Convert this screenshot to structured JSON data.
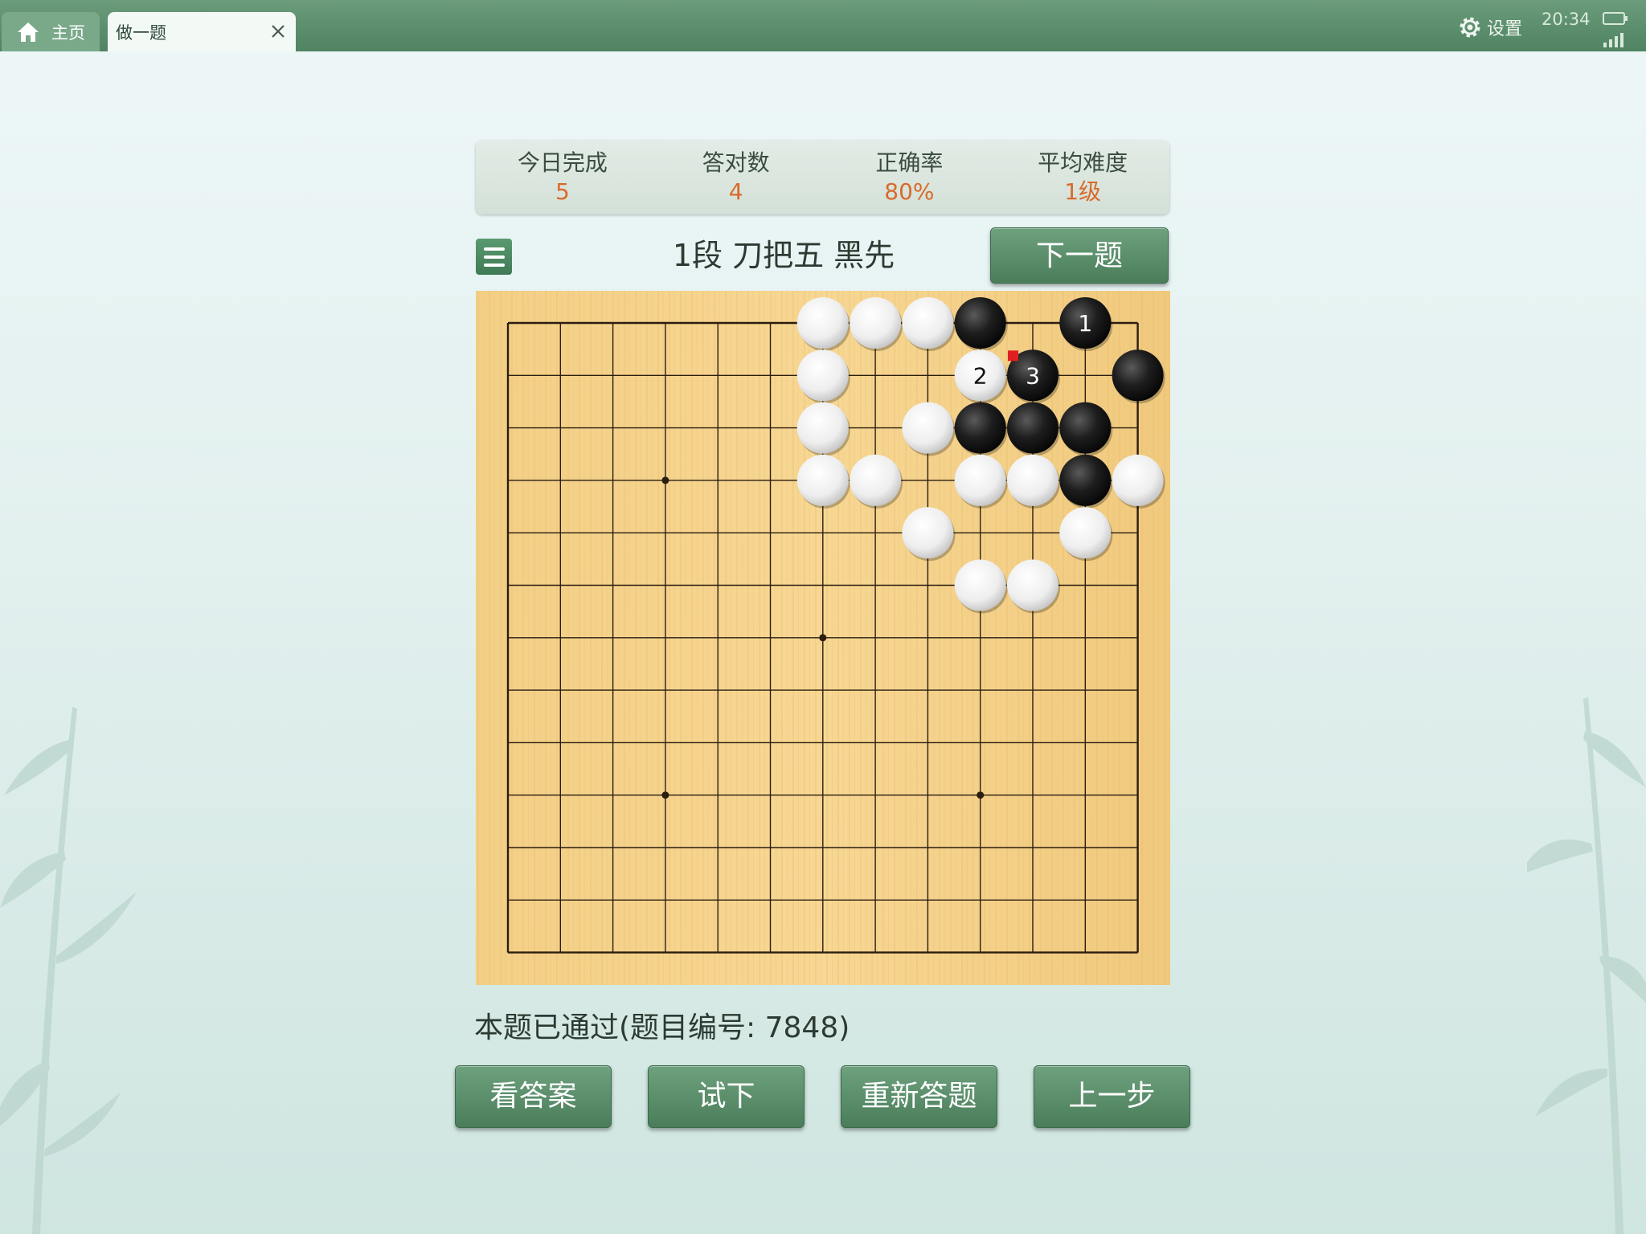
{
  "tabs": {
    "home_label": "主页",
    "active_label": "做一题"
  },
  "status_bar": {
    "settings_label": "设置",
    "time": "20:34"
  },
  "stats": [
    {
      "label": "今日完成",
      "value": "5"
    },
    {
      "label": "答对数",
      "value": "4"
    },
    {
      "label": "正确率",
      "value": "80%"
    },
    {
      "label": "平均难度",
      "value": "1级"
    }
  ],
  "puzzle": {
    "title": "1段 刀把五 黑先",
    "next_label": "下一题",
    "status": "本题已通过(题目编号: 7848)"
  },
  "actions": [
    "看答案",
    "试下",
    "重新答题",
    "上一步"
  ],
  "board": {
    "size": 13,
    "star_points": [
      [
        3,
        3
      ],
      [
        6,
        6
      ],
      [
        3,
        9
      ],
      [
        9,
        9
      ]
    ],
    "stones": [
      {
        "col": 6,
        "row": 0,
        "color": "white"
      },
      {
        "col": 7,
        "row": 0,
        "color": "white"
      },
      {
        "col": 8,
        "row": 0,
        "color": "white"
      },
      {
        "col": 9,
        "row": 0,
        "color": "black"
      },
      {
        "col": 11,
        "row": 0,
        "color": "black",
        "label": "1"
      },
      {
        "col": 6,
        "row": 1,
        "color": "white"
      },
      {
        "col": 9,
        "row": 1,
        "color": "white",
        "label": "2"
      },
      {
        "col": 10,
        "row": 1,
        "color": "black",
        "label": "3",
        "last_move": true
      },
      {
        "col": 12,
        "row": 1,
        "color": "black"
      },
      {
        "col": 6,
        "row": 2,
        "color": "white"
      },
      {
        "col": 8,
        "row": 2,
        "color": "white"
      },
      {
        "col": 9,
        "row": 2,
        "color": "black"
      },
      {
        "col": 10,
        "row": 2,
        "color": "black"
      },
      {
        "col": 11,
        "row": 2,
        "color": "black"
      },
      {
        "col": 6,
        "row": 3,
        "color": "white"
      },
      {
        "col": 7,
        "row": 3,
        "color": "white"
      },
      {
        "col": 9,
        "row": 3,
        "color": "white"
      },
      {
        "col": 10,
        "row": 3,
        "color": "white"
      },
      {
        "col": 11,
        "row": 3,
        "color": "black"
      },
      {
        "col": 12,
        "row": 3,
        "color": "white"
      },
      {
        "col": 8,
        "row": 4,
        "color": "white"
      },
      {
        "col": 11,
        "row": 4,
        "color": "white"
      },
      {
        "col": 9,
        "row": 5,
        "color": "white"
      },
      {
        "col": 10,
        "row": 5,
        "color": "white"
      }
    ]
  },
  "colors": {
    "accent": "#4f8361",
    "stat_value": "#d96a2b",
    "last_move_marker": "#e02020"
  }
}
